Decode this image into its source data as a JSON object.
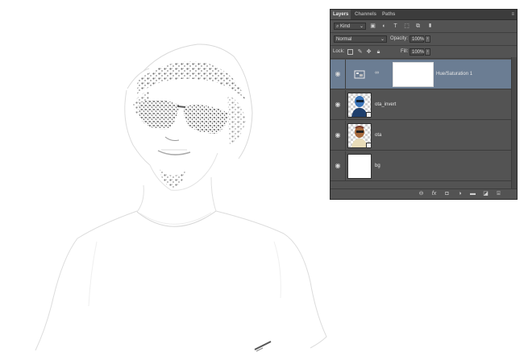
{
  "layers_panel": {
    "tabs": [
      {
        "label": "Layers",
        "active": true
      },
      {
        "label": "Channels",
        "active": false
      },
      {
        "label": "Paths",
        "active": false
      }
    ],
    "filter_kind": "Kind",
    "blend_mode": "Normal",
    "opacity_label": "Opacity:",
    "opacity_value": "100%",
    "lock_label": "Lock:",
    "fill_label": "Fill:",
    "fill_value": "100%",
    "layers": [
      {
        "name": "Hue/Saturation 1",
        "type": "adjustment",
        "selected": true,
        "visible": true
      },
      {
        "name": "ota_invert",
        "type": "smart-object",
        "selected": false,
        "visible": true
      },
      {
        "name": "ota",
        "type": "smart-object",
        "selected": false,
        "visible": true
      },
      {
        "name": "bg",
        "type": "fill",
        "selected": false,
        "visible": true
      }
    ],
    "bottom_icons": [
      "link-icon",
      "fx-icon",
      "mask-icon",
      "adjustment-icon",
      "folder-icon",
      "new-layer-icon",
      "trash-icon"
    ]
  },
  "colors": {
    "panel_bg": "#535353",
    "selected_layer": "#6b7d93",
    "canvas_bg": "#ffffff"
  }
}
